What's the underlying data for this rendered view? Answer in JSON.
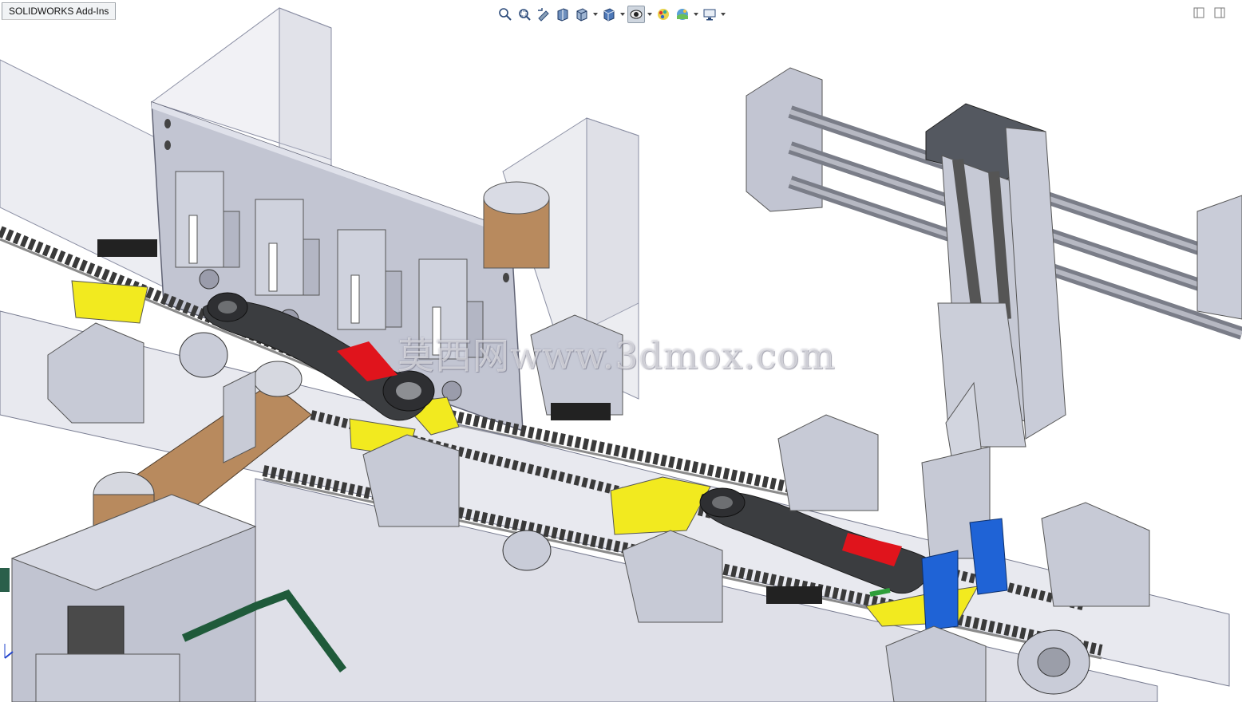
{
  "app": {
    "tab_label": "SOLIDWORKS Add-Ins"
  },
  "heads_up_toolbar": {
    "items": [
      {
        "icon": "zoom-to-fit-icon"
      },
      {
        "icon": "zoom-to-area-icon"
      },
      {
        "icon": "previous-view-icon"
      },
      {
        "icon": "section-view-icon"
      },
      {
        "icon": "view-orientation-icon",
        "has_dropdown": true
      },
      {
        "icon": "display-style-icon",
        "has_dropdown": true
      },
      {
        "icon": "hide-show-items-icon",
        "has_dropdown": true,
        "active": true
      },
      {
        "icon": "edit-appearance-icon"
      },
      {
        "icon": "apply-scene-icon",
        "has_dropdown": true
      },
      {
        "icon": "view-settings-icon",
        "has_dropdown": true
      }
    ]
  },
  "watermark": {
    "text": "莫西网www.3dmox.com"
  },
  "colors": {
    "steel": "#c7cad6",
    "glass": "#b9bdd0",
    "chain": "#5a5a5a",
    "yellow_fixture": "#f2ea1f",
    "red_pad": "#e0141c",
    "blue_gripper": "#1f63d6",
    "copper_belt": "#b88a5e",
    "dark_arm": "#3b3d40"
  }
}
